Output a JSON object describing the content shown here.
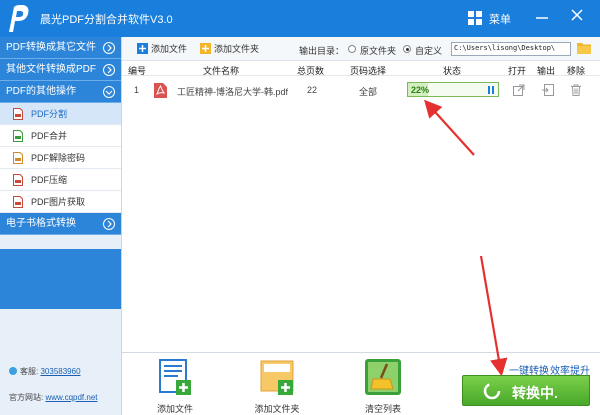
{
  "app": {
    "title": "晨光PDF分割合并软件V3.0",
    "menu_label": "菜单"
  },
  "sidebar": {
    "sections": [
      {
        "label": "PDF转换成其它文件"
      },
      {
        "label": "其他文件转换成PDF"
      },
      {
        "label": "PDF的其他操作"
      }
    ],
    "items": [
      {
        "label": "PDF分割",
        "active": true
      },
      {
        "label": "PDF合并"
      },
      {
        "label": "PDF解除密码"
      },
      {
        "label": "PDF压缩"
      },
      {
        "label": "PDF图片获取"
      }
    ],
    "ebook_section": {
      "label": "电子书格式转换"
    },
    "footer": {
      "qq_label": "客服:",
      "qq_number": "303583960",
      "website_label": "官方网站:",
      "website_url": "www.cqpdf.net"
    }
  },
  "toolbar": {
    "add_file": "添加文件",
    "add_folder": "添加文件夹",
    "output_dir_label": "输出目录：",
    "option_original": "原文件夹",
    "option_custom": "自定义",
    "selected_option": "自定义",
    "output_path": "C:\\Users\\lisong\\Desktop\\"
  },
  "table": {
    "columns": [
      "编号",
      "文件名称",
      "总页数",
      "页码选择",
      "状态",
      "打开",
      "输出",
      "移除"
    ],
    "rows": [
      {
        "index": "1",
        "filename": "工匠精神-博洛尼大学-韩.pdf",
        "pages": "22",
        "page_selection": "全部",
        "progress_text": "22%",
        "progress_value": 0.22
      }
    ]
  },
  "bottom": {
    "add_file": "添加文件",
    "add_folder": "添加文件夹",
    "clear_list": "清空列表",
    "one_click_label": "一键转换",
    "efficiency_label": "效率提升",
    "convert_button": "转换中."
  },
  "colors": {
    "brand_blue": "#1a7fdc",
    "sidebar_blue": "#2c85d8",
    "progress_green": "#7ab85a",
    "convert_green": "#5bbb36",
    "annotation_red": "#e53030"
  }
}
